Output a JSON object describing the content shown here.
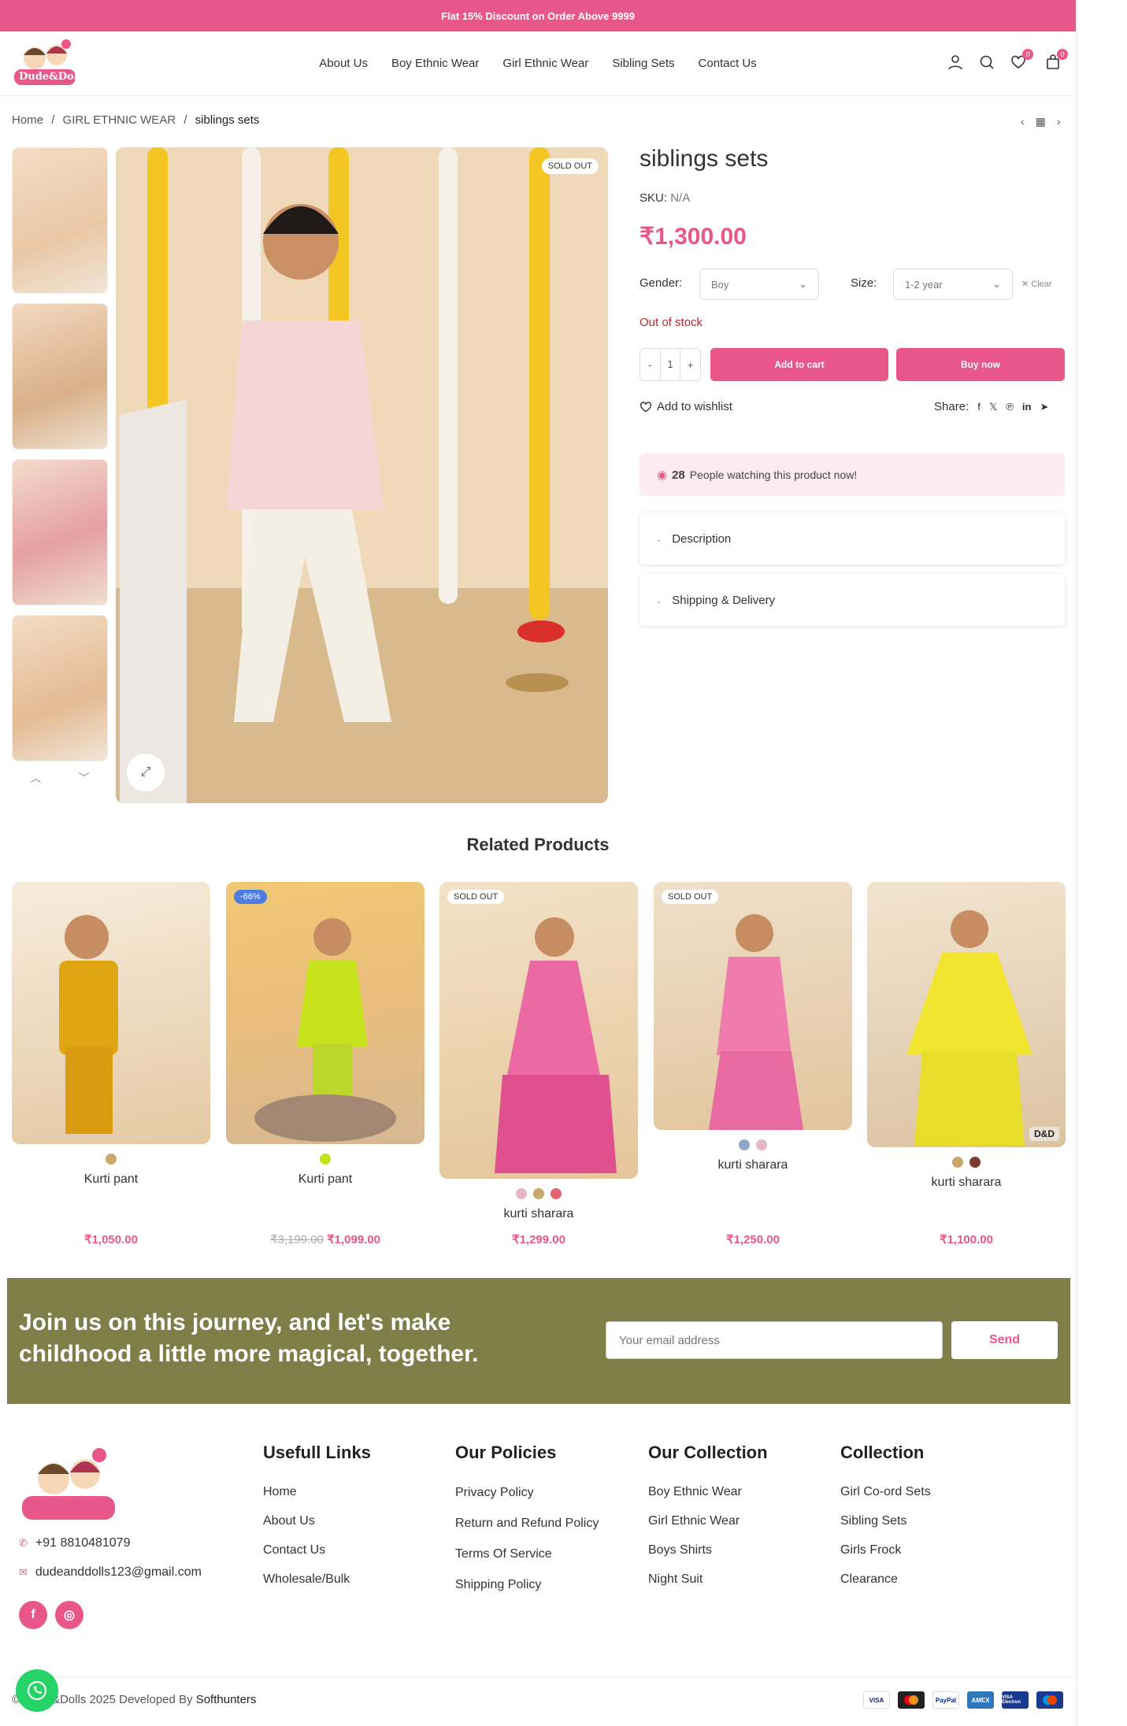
{
  "topbar": {
    "text": "Flat 15% Discount on Order Above 9999"
  },
  "header": {
    "logo_text": "Dude&Dolls",
    "nav": [
      "About Us",
      "Boy Ethnic Wear",
      "Girl Ethnic Wear",
      "Sibling Sets",
      "Contact Us"
    ],
    "wishlist_count": "0",
    "cart_count": "0"
  },
  "breadcrumb": {
    "home": "Home",
    "sep": "/",
    "category": "GIRL ETHNIC WEAR",
    "current": "siblings sets"
  },
  "product": {
    "sold_badge": "SOLD OUT",
    "title": "siblings sets",
    "sku_label": "SKU:",
    "sku_value": "N/A",
    "price": "₹1,300.00",
    "gender_label": "Gender:",
    "gender_value": "Boy",
    "size_label": "Size:",
    "size_value": "1-2 year",
    "clear_label": "Clear",
    "stock": "Out of stock",
    "qty_minus": "-",
    "qty_value": "1",
    "qty_plus": "+",
    "add_to_cart": "Add to cart",
    "buy_now": "Buy now",
    "wishlist": "Add to wishlist",
    "share_label": "Share:",
    "watch_count": "28",
    "watch_text": "People watching this product now!",
    "tabs": [
      "Description",
      "Shipping & Delivery"
    ]
  },
  "related": {
    "title": "Related Products",
    "items": [
      {
        "name": "Kurti pant",
        "badge": "",
        "price": "₹1,050.00",
        "old_price": "",
        "swatches": [
          "#c8a96a"
        ]
      },
      {
        "name": "Kurti pant",
        "badge": "-66%",
        "price": "₹1,099.00",
        "old_price": "₹3,199.00",
        "swatches": [
          "#c6e21a"
        ]
      },
      {
        "name": "kurti sharara",
        "badge": "SOLD OUT",
        "price": "₹1,299.00",
        "old_price": "",
        "swatches": [
          "#e7b7c8",
          "#c8a96a",
          "#e2646f"
        ]
      },
      {
        "name": "kurti sharara",
        "badge": "SOLD OUT",
        "price": "₹1,250.00",
        "old_price": "",
        "swatches": [
          "#8fa8c9",
          "#e7b7c8"
        ]
      },
      {
        "name": "kurti sharara",
        "badge": "",
        "price": "₹1,100.00",
        "old_price": "",
        "swatches": [
          "#c8a96a",
          "#7a3b2e"
        ],
        "brand_tag": "D&D"
      }
    ]
  },
  "newsletter": {
    "heading": "Join us on this journey, and let's make childhood a little more magical, together.",
    "placeholder": "Your email address",
    "button": "Send"
  },
  "footer": {
    "phone": "+91 8810481079",
    "email": "dudeanddolls123@gmail.com",
    "columns": [
      {
        "title": "Usefull Links",
        "links": [
          "Home",
          "About Us",
          "Contact Us",
          "Wholesale/Bulk"
        ]
      },
      {
        "title": "Our Policies",
        "links": [
          "Privacy Policy",
          "Return and Refund Policy",
          "Terms Of Service",
          "Shipping Policy"
        ]
      },
      {
        "title": "Our Collection",
        "links": [
          "Boy Ethnic Wear",
          "Girl Ethnic Wear",
          "Boys Shirts",
          "Night Suit"
        ]
      },
      {
        "title": "Collection",
        "links": [
          "Girl Co-ord Sets",
          "Sibling Sets",
          "Girls Frock",
          "Clearance"
        ]
      }
    ],
    "copyright_prefix": "© Dude&Dolls 2025 Developed By",
    "copyright_brand": "Softhunters",
    "payments": [
      "VISA",
      "MC",
      "PayPal",
      "AMEX",
      "VISA Electron",
      "Maestro"
    ]
  },
  "colors": {
    "accent": "#e9578a",
    "newsletter_bg": "#7f7d48",
    "stock": "#b32d2e"
  }
}
